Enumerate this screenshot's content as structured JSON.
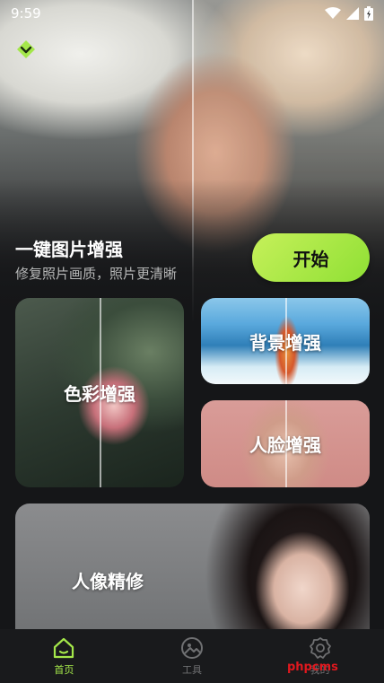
{
  "status_bar": {
    "time": "9:59"
  },
  "hero": {
    "title": "一键图片增强",
    "subtitle": "修复照片画质，照片更清晰",
    "start_button": "开始"
  },
  "cards": {
    "color": "色彩增强",
    "background": "背景增强",
    "face": "人脸增强",
    "portrait": "人像精修"
  },
  "bottom_nav": {
    "items": [
      {
        "label": "首页",
        "icon": "home-icon",
        "active": true
      },
      {
        "label": "工具",
        "icon": "image-tool-icon",
        "active": false
      },
      {
        "label": "我的",
        "icon": "settings-icon",
        "active": false
      }
    ]
  },
  "watermark": "phpcms",
  "colors": {
    "accent": "#a4e74a",
    "start_button_gradient": [
      "#c6f05a",
      "#8fe034"
    ],
    "background": "#151618"
  }
}
